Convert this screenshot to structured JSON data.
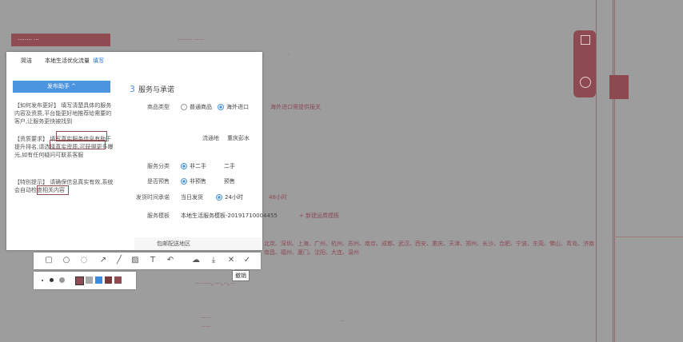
{
  "background_texts": {
    "badge": "········ ···",
    "top_link": "········ ······",
    "left_list": [
      "········",
      "·····",
      "····"
    ],
    "row_marks": [
      "·",
      "··"
    ],
    "cities_row1": "北京、深圳、上海、广州、杭州、苏州、南京、成都、武汉、西安、重庆、天津、郑州、长沙、合肥、宁波、东莞、佛山、青岛、济南",
    "cities_row2": "南昌、福州、厦门、沈阳、大连、温州",
    "cities_row3": "·········、····、··、···",
    "bottom_left": [
      "······",
      "·····"
    ],
    "bottom_mark": "··"
  },
  "dialog": {
    "tabs": [
      "简洁",
      "本地生活优化流量",
      "填写"
    ],
    "publish_button": "发布助手 ^",
    "help_paragraphs": [
      "【如何发布更好】 填写清楚具体的服务内容及资质,平台能更好地推荐给需要的客户,让服务更快被找到",
      "【资质要求】 填写真实服务信息有助于提升排名,请选择真实资质,可获得更多曝光,如有任何疑问可联系客服",
      "【特别提示】 请确保信息真实有效,系统会自动检查相关内容"
    ],
    "section_number": "3",
    "section_title": "服务与承诺",
    "rows": [
      {
        "label": "商品类型",
        "options": [
          "普通商品",
          "海外进口"
        ],
        "selected": 1,
        "note": "海外进口需提供报关"
      },
      {
        "label": "流通地",
        "options": [
          "重庆彭水"
        ],
        "selected": -1,
        "note": ""
      },
      {
        "label": "服务分类",
        "options": [
          "非二手",
          "二手"
        ],
        "selected": 0,
        "note": ""
      },
      {
        "label": "是否预售",
        "options": [
          "非预售",
          "预售"
        ],
        "selected": 0,
        "note": ""
      },
      {
        "label": "发货时间承诺",
        "options": [
          "当日发货",
          "24小时"
        ],
        "selected": 1,
        "note": "48小时"
      },
      {
        "label": "服务模板",
        "options": [
          "本地生活服务模板-20191710004455"
        ],
        "selected": -1,
        "note": "+ 新建运费模板"
      }
    ],
    "area_label": "包邮配送地区"
  },
  "toolbar": {
    "tools": [
      "rect-tool-icon",
      "ellipse-tool-icon",
      "bubble-tool-icon",
      "arrow-tool-icon",
      "pen-tool-icon",
      "mosaic-tool-icon",
      "text-tool-icon",
      "undo-icon",
      "cloud-icon",
      "download-icon",
      "close-icon",
      "check-icon"
    ],
    "tooltip": "撤销"
  },
  "palette": {
    "colors": [
      "#8f4c52",
      "#aaaaaa",
      "#3b8be0",
      "#7a3a3a",
      "#8f4c52"
    ]
  }
}
